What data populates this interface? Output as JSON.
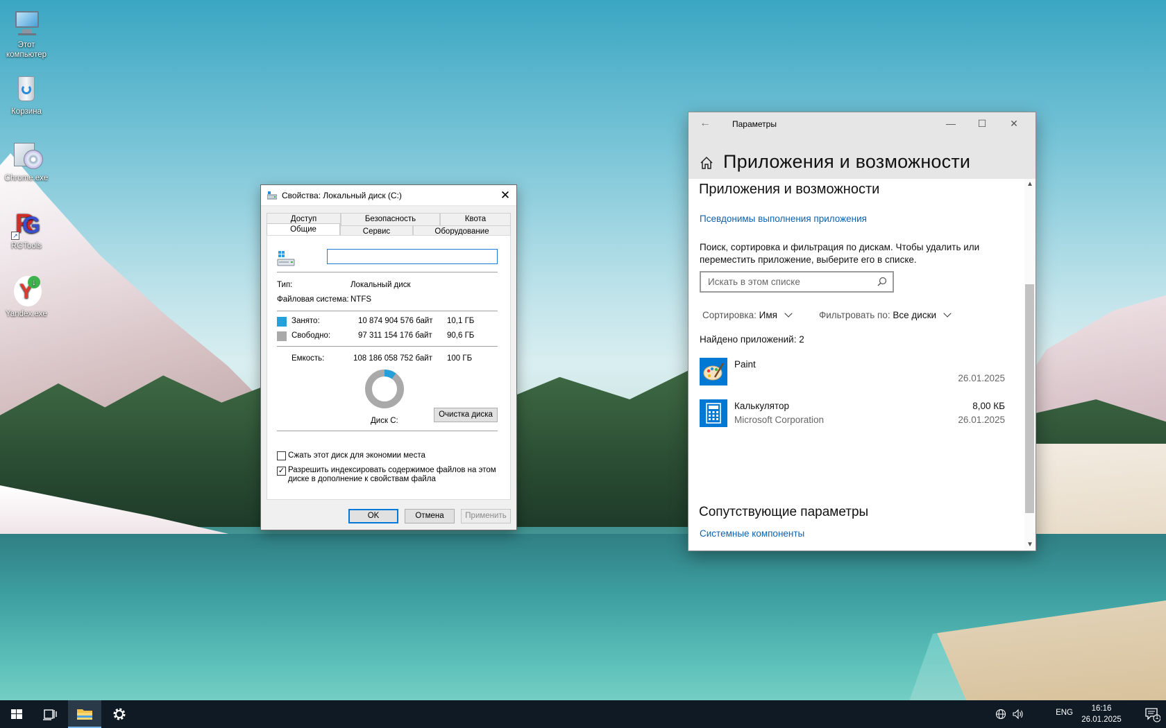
{
  "desktop": {
    "icons": [
      {
        "label_line1": "Этот",
        "label_line2": "компьютер",
        "icon": "this-pc-icon"
      },
      {
        "label": "Корзина",
        "icon": "recycle-bin-icon"
      },
      {
        "label": "Chrome.exe",
        "icon": "installer-disc-icon"
      },
      {
        "label": "RGTools",
        "icon": "rgtools-icon"
      },
      {
        "label": "Yandex.exe",
        "icon": "yandex-browser-icon"
      }
    ]
  },
  "properties": {
    "title": "Свойства: Локальный диск (C:)",
    "tabs_back": [
      "Доступ",
      "Безопасность",
      "Квота"
    ],
    "tabs_front": [
      "Общие",
      "Сервис",
      "Оборудование"
    ],
    "active_tab": "Общие",
    "drive_name_value": "",
    "type_label": "Тип:",
    "type_value": "Локальный диск",
    "fs_label": "Файловая система:",
    "fs_value": "NTFS",
    "used_label": "Занято:",
    "used_bytes": "10 874 904 576 байт",
    "used_gb": "10,1 ГБ",
    "free_label": "Свободно:",
    "free_bytes": "97 311 154 176 байт",
    "free_gb": "90,6 ГБ",
    "capacity_label": "Емкость:",
    "capacity_bytes": "108 186 058 752 байт",
    "capacity_gb": "100 ГБ",
    "used_fraction": 0.1005,
    "disk_label": "Диск C:",
    "cleanup_button": "Очистка диска",
    "compress_label": "Сжать этот диск для экономии места",
    "compress_checked": false,
    "index_label_line1": "Разрешить индексировать содержимое файлов на этом",
    "index_label_line2": "диске в дополнение к свойствам файла",
    "index_checked": true,
    "ok_button": "OK",
    "cancel_button": "Отмена",
    "apply_button": "Применить",
    "colors": {
      "used": "#26a0da",
      "free": "#a9a9a9"
    }
  },
  "settings": {
    "window_title": "Параметры",
    "page_title": "Приложения и возможности",
    "section_title": "Приложения и возможности",
    "aliases_link": "Псевдонимы выполнения приложения",
    "description": "Поиск, сортировка и фильтрация по дискам. Чтобы удалить или переместить приложение, выберите его в списке.",
    "search_placeholder": "Искать в этом списке",
    "sort_label": "Сортировка:",
    "sort_value": "Имя",
    "filter_label": "Фильтровать по:",
    "filter_value": "Все диски",
    "found_text": "Найдено приложений: 2",
    "apps": [
      {
        "name": "Paint",
        "publisher": "",
        "size": "",
        "date": "26.01.2025",
        "icon": "paint-icon"
      },
      {
        "name": "Калькулятор",
        "publisher": "Microsoft Corporation",
        "size": "8,00 КБ",
        "date": "26.01.2025",
        "icon": "calculator-icon"
      }
    ],
    "related_title": "Сопутствующие параметры",
    "components_link": "Системные компоненты",
    "accent": "#0078d4"
  },
  "taskbar": {
    "lang": "ENG",
    "time": "16:16",
    "date": "26.01.2025",
    "notification_count": "1"
  }
}
